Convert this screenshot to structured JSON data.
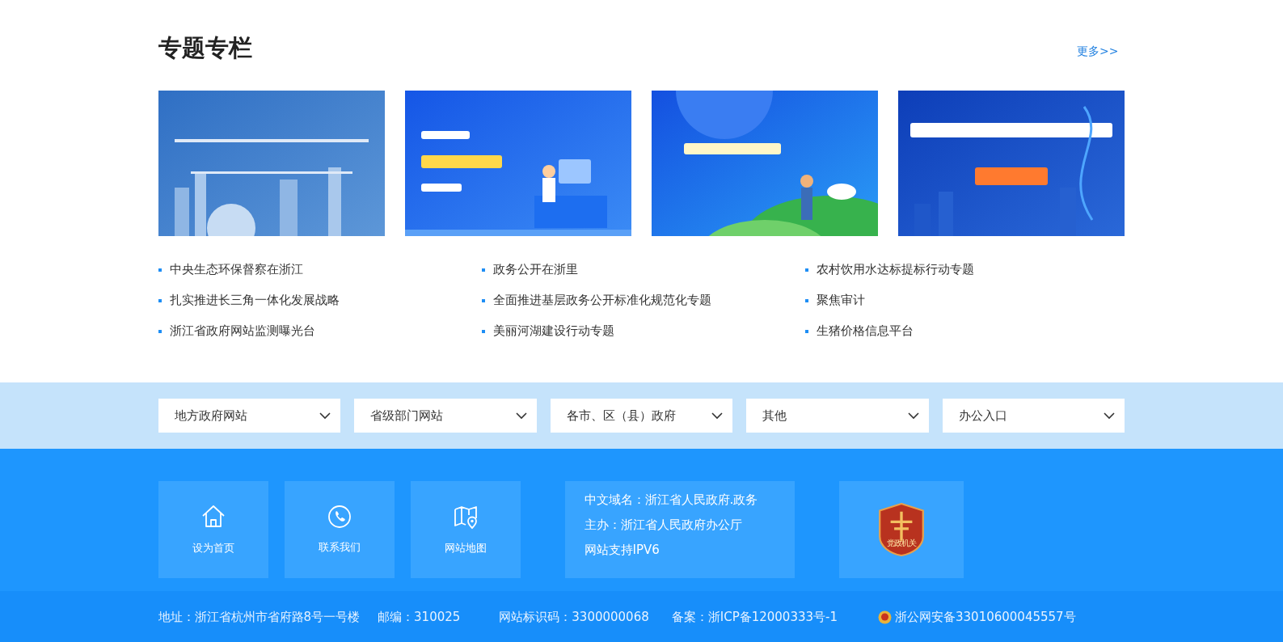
{
  "section": {
    "title": "专题专栏",
    "more_link": "更多>>"
  },
  "banners": [
    {
      "kind": "picture"
    },
    {
      "kind": "picture"
    },
    {
      "kind": "picture"
    },
    {
      "kind": "picture"
    }
  ],
  "topics": [
    [
      "中央生态环保督察在浙江",
      "扎实推进长三角一体化发展战略",
      "浙江省政府网站监测曝光台"
    ],
    [
      "政务公开在浙里",
      "全面推进基层政务公开标准化规范化专题",
      "美丽河湖建设行动专题"
    ],
    [
      "农村饮用水达标提标行动专题",
      "聚焦审计",
      "生猪价格信息平台"
    ]
  ],
  "site_selectors": [
    "地方政府网站",
    "省级部门网站",
    "各市、区（县）政府",
    "其他",
    "办公入口"
  ],
  "footer": {
    "tiles": [
      {
        "kind": "home",
        "label": "设为首页"
      },
      {
        "kind": "phone",
        "label": "联系我们"
      },
      {
        "kind": "map",
        "label": "网站地图"
      }
    ],
    "info": [
      "中文域名：浙江省人民政府.政务",
      "主办：浙江省人民政府办公厅",
      "网站支持IPV6"
    ],
    "emblem_label": "党政机关"
  },
  "bottom_bar": {
    "address": "地址：浙江省杭州市省府路8号一号楼",
    "postcode": "邮编：310025",
    "site_code": "网站标识码：3300000068",
    "icp": "备案：浙ICP备12000333号-1",
    "police": "浙公网安备33010600045557号"
  }
}
